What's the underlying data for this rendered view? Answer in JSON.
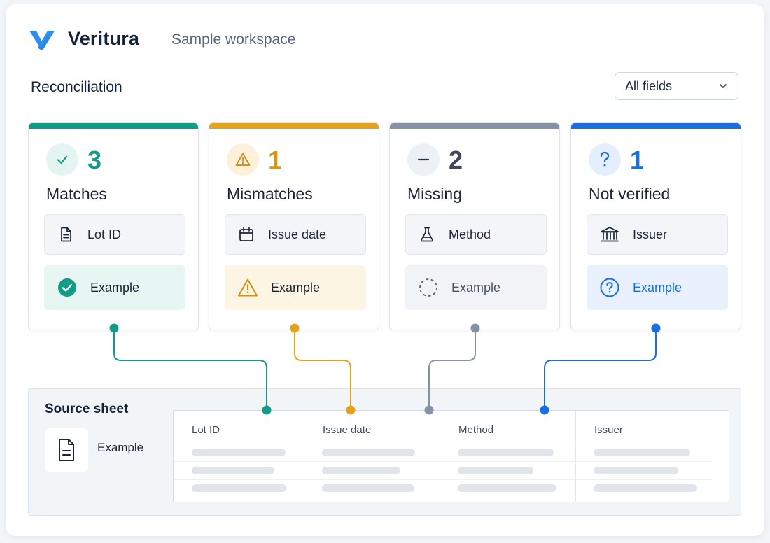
{
  "header": {
    "brand": "Veritura",
    "workspace": "Sample workspace"
  },
  "page": {
    "title": "Reconciliation",
    "filter": {
      "selected": "All fields"
    }
  },
  "cards": [
    {
      "count": "3",
      "label": "Matches",
      "field": "Lot ID",
      "field_icon": "document-icon",
      "status_icon": "check-icon",
      "example": "Example",
      "example_icon": "check-circle-icon",
      "accent": "#129b86",
      "soft": "#e7f6f3"
    },
    {
      "count": "1",
      "label": "Mismatches",
      "field": "Issue date",
      "field_icon": "calendar-icon",
      "status_icon": "warning-icon",
      "example": "Example",
      "example_icon": "warning-triangle-icon",
      "accent": "#e2a21c",
      "soft": "#fdf5e4"
    },
    {
      "count": "2",
      "label": "Missing",
      "field": "Method",
      "field_icon": "flask-icon",
      "status_icon": "minus-icon",
      "example": "Example",
      "example_icon": "dashed-circle-icon",
      "accent": "#8591a4",
      "soft": "#f1f3f6"
    },
    {
      "count": "1",
      "label": "Not verified",
      "field": "Issuer",
      "field_icon": "bank-icon",
      "status_icon": "question-icon",
      "example": "Example",
      "example_icon": "question-circle-icon",
      "accent": "#1a6fe0",
      "soft": "#e8f1fd"
    }
  ],
  "source": {
    "title": "Source sheet",
    "document": "Example",
    "columns": [
      "Lot ID",
      "Issue date",
      "Method",
      "Issuer"
    ]
  }
}
